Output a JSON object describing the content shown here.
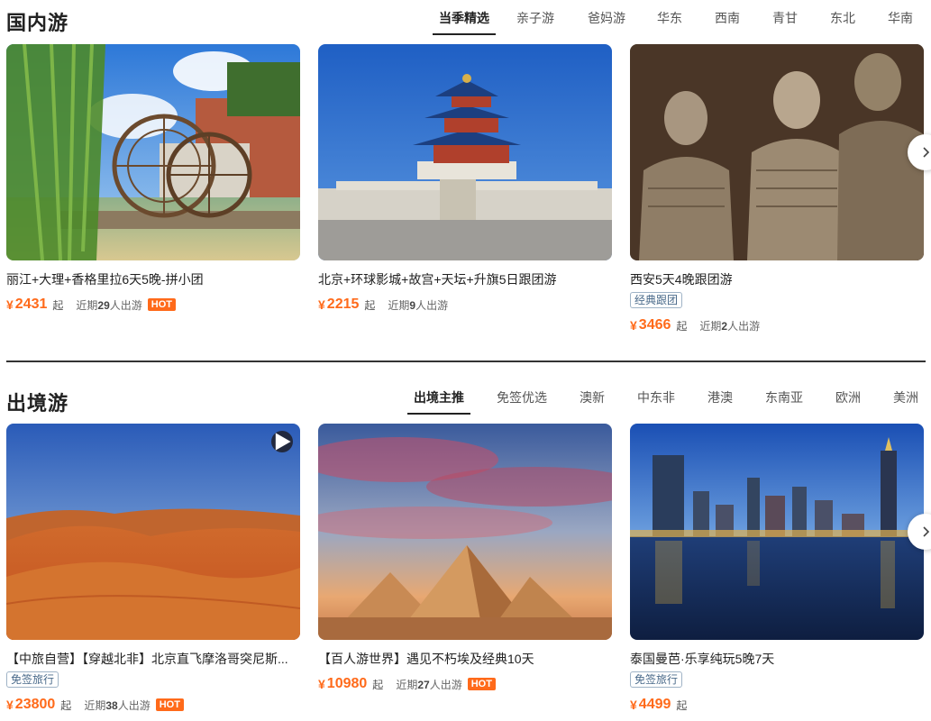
{
  "domestic": {
    "title": "国内游",
    "tabs": [
      "当季精选",
      "亲子游",
      "爸妈游",
      "华东",
      "西南",
      "青甘",
      "东北",
      "华南"
    ],
    "cards": [
      {
        "title": "丽江+大理+香格里拉6天5晚-拼小团",
        "tag": "",
        "yen": "¥",
        "price": "2431",
        "qi": "起",
        "recent_prefix": "近期",
        "recent_count": "29",
        "recent_suffix": "人出游",
        "hot": "HOT"
      },
      {
        "title": "北京+环球影城+故宫+天坛+升旗5日跟团游",
        "tag": "",
        "yen": "¥",
        "price": "2215",
        "qi": "起",
        "recent_prefix": "近期",
        "recent_count": "9",
        "recent_suffix": "人出游",
        "hot": ""
      },
      {
        "title": "西安5天4晚跟团游",
        "tag": "经典跟团",
        "yen": "¥",
        "price": "3466",
        "qi": "起",
        "recent_prefix": "近期",
        "recent_count": "2",
        "recent_suffix": "人出游",
        "hot": ""
      }
    ]
  },
  "outbound": {
    "title": "出境游",
    "tabs": [
      "出境主推",
      "免签优选",
      "澳新",
      "中东非",
      "港澳",
      "东南亚",
      "欧洲",
      "美洲"
    ],
    "cards": [
      {
        "title": "【中旅自营】【穿越北非】北京直飞摩洛哥突尼斯...",
        "tag": "免签旅行",
        "yen": "¥",
        "price": "23800",
        "qi": "起",
        "recent_prefix": "近期",
        "recent_count": "38",
        "recent_suffix": "人出游",
        "hot": "HOT"
      },
      {
        "title": "【百人游世界】遇见不朽埃及经典10天",
        "tag": "",
        "yen": "¥",
        "price": "10980",
        "qi": "起",
        "recent_prefix": "近期",
        "recent_count": "27",
        "recent_suffix": "人出游",
        "hot": "HOT"
      },
      {
        "title": "泰国曼芭·乐享纯玩5晚7天",
        "tag": "免签旅行",
        "yen": "¥",
        "price": "4499",
        "qi": "起",
        "recent_prefix": "",
        "recent_count": "",
        "recent_suffix": "",
        "hot": ""
      }
    ]
  },
  "icons": {
    "next": "chevron-right-icon",
    "play": "play-icon"
  },
  "colors": {
    "price": "#ff6a1a",
    "hot_bg": "#ff6a1a",
    "tag_border": "#9fb3c6"
  }
}
